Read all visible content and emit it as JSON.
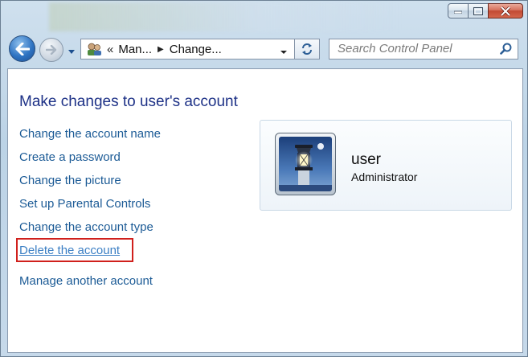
{
  "window": {
    "caption_buttons": [
      "minimize",
      "maximize",
      "close"
    ]
  },
  "navigation": {
    "address_crumbs": [
      "Man...",
      "Change..."
    ],
    "address_prefix": "«",
    "search_placeholder": "Search Control Panel"
  },
  "page": {
    "title": "Make changes to user's account",
    "tasks": [
      "Change the account name",
      "Create a password",
      "Change the picture",
      "Set up Parental Controls",
      "Change the account type",
      "Delete the account"
    ],
    "manage_link": "Manage another account",
    "highlighted_task": "Delete the account",
    "highlight_color": "#d0201c"
  },
  "account": {
    "name": "user",
    "role": "Administrator",
    "picture": "lighthouse-picture"
  },
  "colors": {
    "link": "#1c5b96",
    "title": "#1e3287"
  }
}
